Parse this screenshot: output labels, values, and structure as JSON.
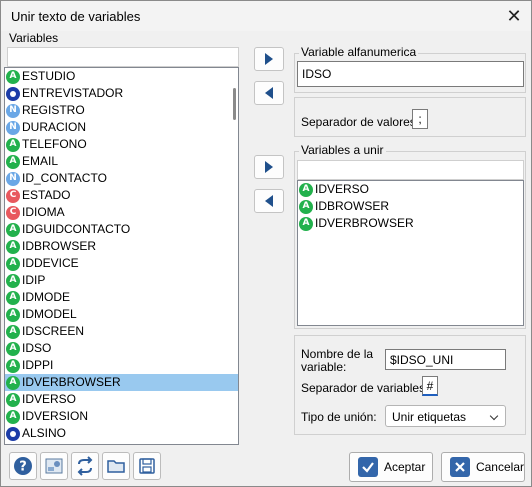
{
  "window": {
    "title": "Unir texto de variables",
    "close_glyph": "✕"
  },
  "left": {
    "group_label": "Variables",
    "search_value": "",
    "items": [
      {
        "type": "A",
        "label": "ESTUDIO"
      },
      {
        "type": "O",
        "label": "ENTREVISTADOR"
      },
      {
        "type": "N",
        "label": "REGISTRO"
      },
      {
        "type": "N",
        "label": "DURACION"
      },
      {
        "type": "A",
        "label": "TELEFONO"
      },
      {
        "type": "A",
        "label": "EMAIL"
      },
      {
        "type": "N",
        "label": "ID_CONTACTO"
      },
      {
        "type": "C",
        "label": "ESTADO"
      },
      {
        "type": "C",
        "label": "IDIOMA"
      },
      {
        "type": "A",
        "label": "IDGUIDCONTACTO"
      },
      {
        "type": "A",
        "label": "IDBROWSER"
      },
      {
        "type": "A",
        "label": "IDDEVICE"
      },
      {
        "type": "A",
        "label": "IDIP"
      },
      {
        "type": "A",
        "label": "IDMODE"
      },
      {
        "type": "A",
        "label": "IDMODEL"
      },
      {
        "type": "A",
        "label": "IDSCREEN"
      },
      {
        "type": "A",
        "label": "IDSO"
      },
      {
        "type": "A",
        "label": "IDPPI"
      },
      {
        "type": "A",
        "label": "IDVERBROWSER",
        "selected": true
      },
      {
        "type": "A",
        "label": "IDVERSO"
      },
      {
        "type": "A",
        "label": "IDVERSION"
      },
      {
        "type": "O",
        "label": "ALSINO"
      }
    ]
  },
  "right": {
    "alfanumerica": {
      "label": "Variable alfanumerica",
      "value": "IDSO"
    },
    "separador_valores": {
      "label": "Separador de valores:",
      "value": ";"
    },
    "a_unir": {
      "label": "Variables a unir",
      "search_value": "",
      "items": [
        {
          "type": "A",
          "label": "IDVERSO"
        },
        {
          "type": "A",
          "label": "IDBROWSER"
        },
        {
          "type": "A",
          "label": "IDVERBROWSER"
        }
      ]
    },
    "nombre": {
      "label_line1": "Nombre de la",
      "label_line2": "variable:",
      "value": "$IDSO_UNI"
    },
    "separador_variables": {
      "label": "Separador de variables:",
      "value": "#"
    },
    "tipo_union": {
      "label": "Tipo de unión:",
      "value": "Unir etiquetas"
    }
  },
  "footer": {
    "accept_label": "Aceptar",
    "cancel_label": "Cancelar"
  },
  "colors": {
    "badge_A": "#22b14c",
    "badge_N": "#6aa7e6",
    "badge_C": "#e8585e",
    "badge_O": "#1c3ca8",
    "selection": "#99c9ef",
    "arrow": "#1f4f8b"
  },
  "icons": [
    "help-icon",
    "settings-image-icon",
    "refresh-icon",
    "open-folder-icon",
    "save-icon",
    "check-icon",
    "cancel-x-icon"
  ]
}
